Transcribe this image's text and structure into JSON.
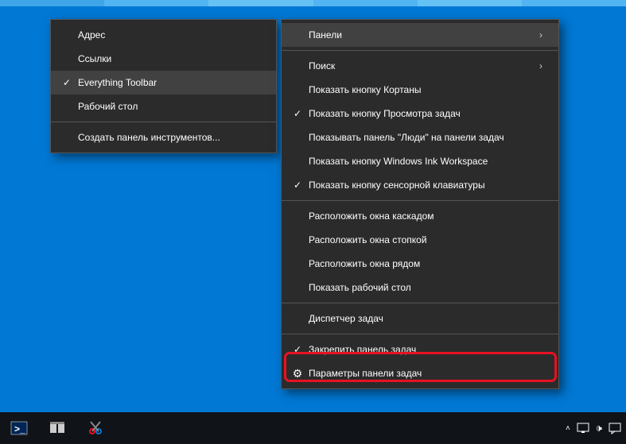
{
  "submenu": {
    "items": [
      {
        "label": "Адрес",
        "checked": false
      },
      {
        "label": "Ссылки",
        "checked": false
      },
      {
        "label": "Everything Toolbar",
        "checked": true,
        "hover": true
      },
      {
        "label": "Рабочий стол",
        "checked": false
      }
    ],
    "footer": {
      "label": "Создать панель инструментов..."
    }
  },
  "mainmenu": {
    "group1": [
      {
        "label": "Панели",
        "arrow": true,
        "hover": true
      },
      {
        "label": "Поиск",
        "arrow": true
      },
      {
        "label": "Показать кнопку Кортаны",
        "checked": false
      },
      {
        "label": "Показать кнопку Просмотра задач",
        "checked": true
      },
      {
        "label": "Показывать панель \"Люди\" на панели задач",
        "checked": false
      },
      {
        "label": "Показать кнопку Windows Ink Workspace",
        "checked": false
      },
      {
        "label": "Показать кнопку сенсорной клавиатуры",
        "checked": true
      }
    ],
    "group2": [
      {
        "label": "Расположить окна каскадом"
      },
      {
        "label": "Расположить окна стопкой"
      },
      {
        "label": "Расположить окна рядом"
      },
      {
        "label": "Показать рабочий стол"
      }
    ],
    "group3": [
      {
        "label": "Диспетчер задач"
      }
    ],
    "group4": [
      {
        "label": "Закрепить панель задач",
        "checked": true
      },
      {
        "label": "Параметры панели задач",
        "gear": true
      }
    ]
  },
  "icons": {
    "check": "✓",
    "arrow": "›",
    "gear": "⚙",
    "chevup": "˄",
    "battery": "🗠",
    "speaker": "🕩",
    "network": "🖧",
    "notify": "💬"
  }
}
